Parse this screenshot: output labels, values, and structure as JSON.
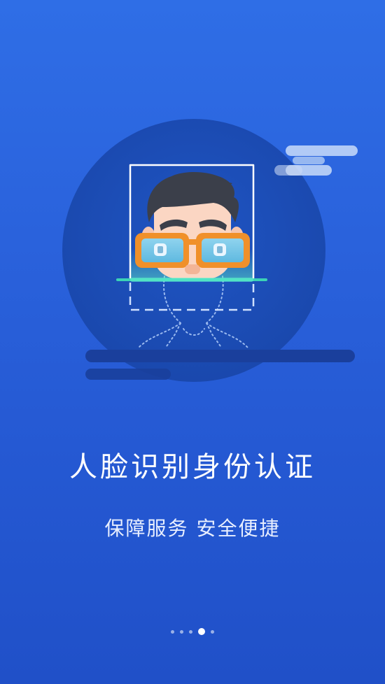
{
  "onboarding": {
    "title": "人脸识别身份认证",
    "subtitle": "保障服务 安全便捷"
  },
  "pager": {
    "total": 5,
    "active_index": 3
  },
  "colors": {
    "background": "#2a62dc",
    "circle": "#1d4fb9",
    "glasses_frame": "#f0902a",
    "hair": "#3b3f4a",
    "skin": "#fbd6c3",
    "scan_line": "#3cd3b5"
  },
  "illustration": {
    "icon": "face-recognition-scan-icon"
  }
}
